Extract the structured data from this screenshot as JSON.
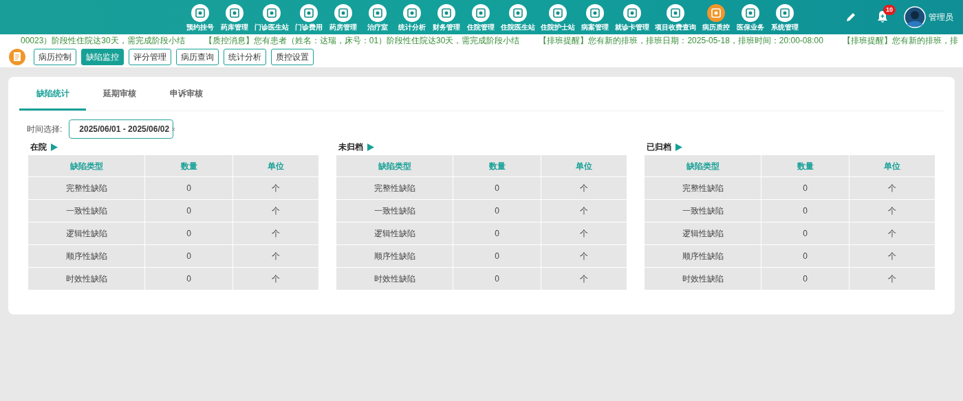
{
  "nav": [
    {
      "label": "预约挂号",
      "selected": false
    },
    {
      "label": "药库管理",
      "selected": false
    },
    {
      "label": "门诊医生站",
      "selected": false
    },
    {
      "label": "门诊费用",
      "selected": false
    },
    {
      "label": "药房管理",
      "selected": false
    },
    {
      "label": "治疗室",
      "selected": false
    },
    {
      "label": "统计分析",
      "selected": false
    },
    {
      "label": "财务管理",
      "selected": false
    },
    {
      "label": "住院管理",
      "selected": false
    },
    {
      "label": "住院医生站",
      "selected": false
    },
    {
      "label": "住院护士站",
      "selected": false
    },
    {
      "label": "病案管理",
      "selected": false
    },
    {
      "label": "就诊卡管理",
      "selected": false
    },
    {
      "label": "项目收费查询",
      "selected": false
    },
    {
      "label": "病历质控",
      "selected": true
    },
    {
      "label": "医保业务",
      "selected": false
    },
    {
      "label": "系统管理",
      "selected": false
    }
  ],
  "notification_count": "10",
  "user": {
    "name": "管理员"
  },
  "messages": [
    "00023）阶段性住院达30天，需完成阶段小结",
    "【质控消息】您有患者（姓名：达瑞，床号：01）阶段性住院达30天，需完成阶段小结",
    "【排班提醒】您有新的排班，排班日期：2025-05-18，排班时间：20:00-08:00",
    "【排班提醒】您有新的排班，排"
  ],
  "sub_nav": [
    {
      "label": "病历控制",
      "selected": false
    },
    {
      "label": "缺陷监控",
      "selected": true
    },
    {
      "label": "评分管理",
      "selected": false
    },
    {
      "label": "病历查询",
      "selected": false
    },
    {
      "label": "统计分析",
      "selected": false
    },
    {
      "label": "质控设置",
      "selected": false
    }
  ],
  "tabs": [
    {
      "label": "缺陷统计",
      "selected": true
    },
    {
      "label": "延期审核",
      "selected": false
    },
    {
      "label": "申诉审核",
      "selected": false
    }
  ],
  "date_filter": {
    "label": "时间选择:",
    "value": "2025/06/01 - 2025/06/02",
    "clear": "×"
  },
  "sections": [
    {
      "title": "在院",
      "columns": [
        "缺陷类型",
        "数量",
        "单位"
      ],
      "rows": [
        [
          "完整性缺陷",
          "0",
          "个"
        ],
        [
          "一致性缺陷",
          "0",
          "个"
        ],
        [
          "逻辑性缺陷",
          "0",
          "个"
        ],
        [
          "顺序性缺陷",
          "0",
          "个"
        ],
        [
          "时效性缺陷",
          "0",
          "个"
        ]
      ]
    },
    {
      "title": "未归档",
      "columns": [
        "缺陷类型",
        "数量",
        "单位"
      ],
      "rows": [
        [
          "完整性缺陷",
          "0",
          "个"
        ],
        [
          "一致性缺陷",
          "0",
          "个"
        ],
        [
          "逻辑性缺陷",
          "0",
          "个"
        ],
        [
          "顺序性缺陷",
          "0",
          "个"
        ],
        [
          "时效性缺陷",
          "0",
          "个"
        ]
      ]
    },
    {
      "title": "已归档",
      "columns": [
        "缺陷类型",
        "数量",
        "单位"
      ],
      "rows": [
        [
          "完整性缺陷",
          "0",
          "个"
        ],
        [
          "一致性缺陷",
          "0",
          "个"
        ],
        [
          "逻辑性缺陷",
          "0",
          "个"
        ],
        [
          "顺序性缺陷",
          "0",
          "个"
        ],
        [
          "时效性缺陷",
          "0",
          "个"
        ]
      ]
    }
  ]
}
